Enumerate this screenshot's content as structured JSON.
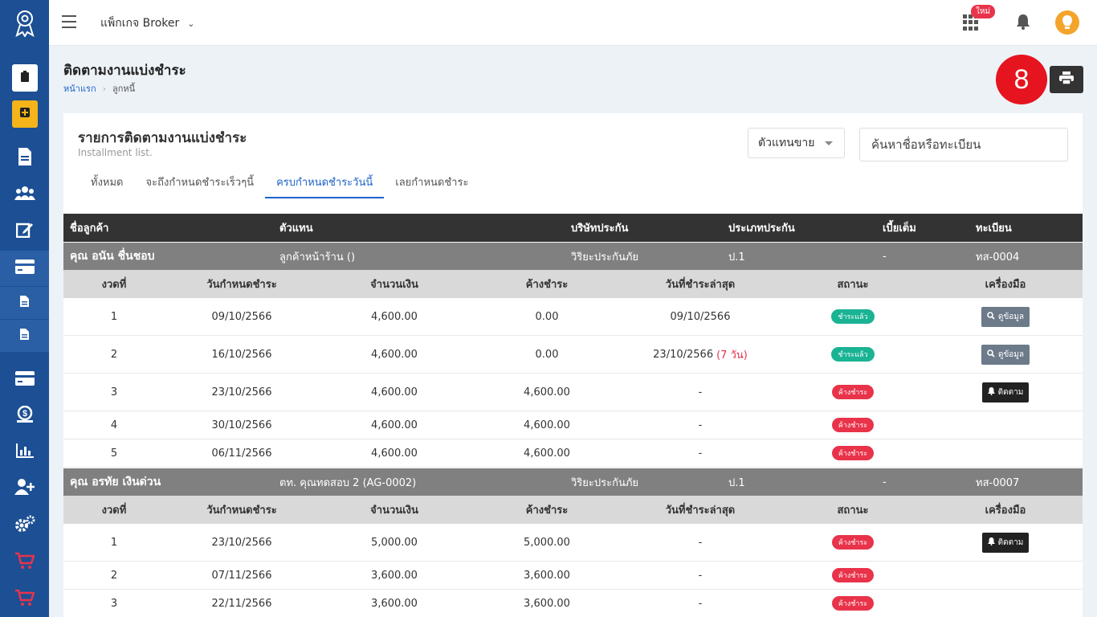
{
  "topbar": {
    "package_label": "แพ็กเกจ Broker",
    "new_badge": "ใหม่"
  },
  "page": {
    "title": "ติดตามงานแบ่งชำระ",
    "breadcrumb": [
      "หน้าแรก",
      "ลูกหนี้"
    ],
    "step_number": "8"
  },
  "card": {
    "title": "รายการติดตามงานแบ่งชำระ",
    "subtitle": "Installment list.",
    "agent_select": "ตัวแทนขาย",
    "search_placeholder": "ค้นหาชื่อหรือทะเบียน",
    "tabs": [
      "ทั้งหมด",
      "จะถึงกำหนดชำระเร็วๆนี้",
      "ครบกำหนดชำระวันนี้",
      "เลยกำหนดชำระ"
    ],
    "active_tab": 2
  },
  "table": {
    "headers": [
      "ชื่อลูกค้า",
      "ตัวแทน",
      "บริษัทประกัน",
      "ประเภทประกัน",
      "เบี้ยเต็ม",
      "ทะเบียน"
    ],
    "sub_headers": [
      "งวดที่",
      "วันกำหนดชำระ",
      "จำนวนเงิน",
      "ค้างชำระ",
      "วันที่ชำระล่าสุด",
      "สถานะ",
      "เครื่องมือ"
    ],
    "customers": [
      {
        "name": "คุณ อนัน ชื่นชอบ",
        "agent": "ลูกค้าหน้าร้าน ()",
        "company": "วิริยะประกันภัย",
        "type": "ป.1",
        "premium": "-",
        "plate": "ทส-0004",
        "installments": [
          {
            "no": "1",
            "due": "09/10/2566",
            "amount": "4,600.00",
            "outstanding": "0.00",
            "last_paid": "09/10/2566",
            "late_note": "",
            "status": "ชำระแล้ว",
            "status_kind": "paid",
            "tool": "ดูข้อมูล",
            "tool_kind": "view"
          },
          {
            "no": "2",
            "due": "16/10/2566",
            "amount": "4,600.00",
            "outstanding": "0.00",
            "last_paid": "23/10/2566",
            "late_note": "(7 วัน)",
            "status": "ชำระแล้ว",
            "status_kind": "paid",
            "tool": "ดูข้อมูล",
            "tool_kind": "view"
          },
          {
            "no": "3",
            "due": "23/10/2566",
            "amount": "4,600.00",
            "outstanding": "4,600.00",
            "last_paid": "-",
            "late_note": "",
            "status": "ค้างชำระ",
            "status_kind": "due",
            "tool": "ติดตาม",
            "tool_kind": "follow"
          },
          {
            "no": "4",
            "due": "30/10/2566",
            "amount": "4,600.00",
            "outstanding": "4,600.00",
            "last_paid": "-",
            "late_note": "",
            "status": "ค้างชำระ",
            "status_kind": "due",
            "tool": "",
            "tool_kind": ""
          },
          {
            "no": "5",
            "due": "06/11/2566",
            "amount": "4,600.00",
            "outstanding": "4,600.00",
            "last_paid": "-",
            "late_note": "",
            "status": "ค้างชำระ",
            "status_kind": "due",
            "tool": "",
            "tool_kind": ""
          }
        ]
      },
      {
        "name": "คุณ อรทัย เงินด่วน",
        "agent": "ตท. คุณทดสอบ 2 (AG-0002)",
        "company": "วิริยะประกันภัย",
        "type": "ป.1",
        "premium": "-",
        "plate": "ทส-0007",
        "installments": [
          {
            "no": "1",
            "due": "23/10/2566",
            "amount": "5,000.00",
            "outstanding": "5,000.00",
            "last_paid": "-",
            "late_note": "",
            "status": "ค้างชำระ",
            "status_kind": "due",
            "tool": "ติดตาม",
            "tool_kind": "follow"
          },
          {
            "no": "2",
            "due": "07/11/2566",
            "amount": "3,600.00",
            "outstanding": "3,600.00",
            "last_paid": "-",
            "late_note": "",
            "status": "ค้างชำระ",
            "status_kind": "due",
            "tool": "",
            "tool_kind": ""
          },
          {
            "no": "3",
            "due": "22/11/2566",
            "amount": "3,600.00",
            "outstanding": "3,600.00",
            "last_paid": "-",
            "late_note": "",
            "status": "ค้างชำระ",
            "status_kind": "due",
            "tool": "",
            "tool_kind": ""
          }
        ]
      }
    ]
  },
  "colors": {
    "sidebar": "#1c4f94",
    "accent": "#1c63c9",
    "paid": "#1ab394",
    "due": "#e8334a",
    "step_badge": "#e5141e"
  },
  "icons": {
    "sidebar": [
      "logo-icon",
      "clipboard-icon",
      "plus-square-icon",
      "file-icon",
      "users-icon",
      "edit-icon",
      "credit-card-icon",
      "file-small-icon",
      "file-small-icon",
      "credit-card-icon",
      "money-bag-icon",
      "bar-chart-icon",
      "user-plus-icon",
      "cogs-icon",
      "cart-icon",
      "cart-icon"
    ]
  }
}
